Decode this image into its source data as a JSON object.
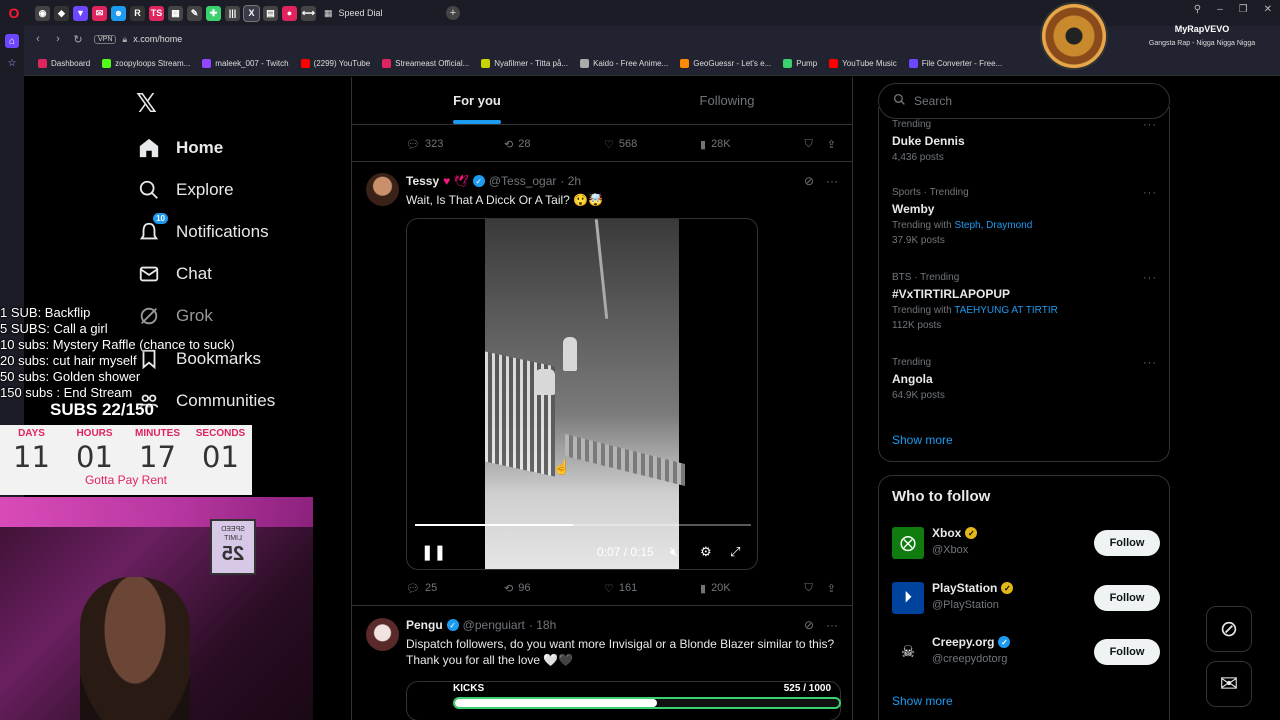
{
  "browser": {
    "speed_dial_tab": "Speed Dial",
    "url": "x.com/home",
    "vpn": "VPN",
    "bookmarks": [
      {
        "label": "Dashboard",
        "color": "#e0245e"
      },
      {
        "label": "zoopyloops Stream...",
        "color": "#53fc18"
      },
      {
        "label": "maleek_007 - Twitch",
        "color": "#9146ff"
      },
      {
        "label": "(2299) YouTube",
        "color": "#ff0000"
      },
      {
        "label": "Streameast Official...",
        "color": "#e0245e"
      },
      {
        "label": "Nyafilmer - Titta på...",
        "color": "#c8d400"
      },
      {
        "label": "Kaido - Free Anime...",
        "color": "#aaaaaa"
      },
      {
        "label": "GeoGuessr - Let's e...",
        "color": "#ff8a00"
      },
      {
        "label": "Pump",
        "color": "#3bd16f"
      },
      {
        "label": "YouTube Music",
        "color": "#ff0000"
      },
      {
        "label": "File Converter - Free...",
        "color": "#6c47ff"
      }
    ]
  },
  "music": {
    "title": "MyRapVEVO",
    "subtitle": "Gangsta Rap - Nigga Nigga Nigga"
  },
  "nav": {
    "home": "Home",
    "explore": "Explore",
    "notifications": "Notifications",
    "notif_badge": "10",
    "chat": "Chat",
    "grok": "Grok",
    "bookmarks": "Bookmarks",
    "communities": "Communities"
  },
  "feed": {
    "tabs": [
      "For you",
      "Following"
    ],
    "prev_stats": {
      "replies": "323",
      "reposts": "28",
      "likes": "568",
      "views": "28K"
    },
    "tweet1": {
      "name": "Tessy",
      "emoji": "♥ 🕊",
      "handle": "@Tess_ogar",
      "time": "· 2h",
      "text": "Wait, Is That A Dicck Or A Tail? 😲🤯",
      "video_time": "0:07 / 0:15",
      "video_progress": 0.47,
      "stats": {
        "replies": "25",
        "reposts": "96",
        "likes": "161",
        "views": "20K"
      }
    },
    "tweet2": {
      "name": "Pengu",
      "handle": "@penguiart",
      "time": "· 18h",
      "text": "Dispatch followers, do you want more Invisigal or a Blonde Blazer similar to this? Thank you for all the love 🤍🖤"
    }
  },
  "sidebar": {
    "search_placeholder": "Search",
    "trends": [
      {
        "meta": "Trending",
        "name": "Duke Dennis",
        "with": "",
        "with_names": "",
        "count": "4,436 posts"
      },
      {
        "meta": "Sports · Trending",
        "name": "Wemby",
        "with": "Trending with",
        "with_names": "Steph, Draymond",
        "count": "37.9K posts"
      },
      {
        "meta": "BTS · Trending",
        "name": "#VxTIRTIRLAPOPUP",
        "with": "Trending with",
        "with_names": "TAEHYUNG AT TIRTIR",
        "count": "112K posts"
      },
      {
        "meta": "Trending",
        "name": "Angola",
        "with": "",
        "with_names": "",
        "count": "64.9K posts"
      }
    ],
    "show_more": "Show more",
    "who_to_follow": "Who to follow",
    "follow_label": "Follow",
    "accounts": [
      {
        "name": "Xbox",
        "handle": "@Xbox",
        "color": "#107c10"
      },
      {
        "name": "PlayStation",
        "handle": "@PlayStation",
        "color": "#00439c"
      },
      {
        "name": "Creepy.org",
        "handle": "@creepydotorg",
        "color": "#000000"
      }
    ]
  },
  "overlay": {
    "goals": [
      "1 SUB: Backflip",
      "5 SUBS: Call a girl",
      "10 subs: Mystery Raffle (chance to suck)",
      "20 subs: cut hair myself",
      "50 subs: Golden shower",
      "150 subs : End Stream"
    ],
    "subs": "SUBS 22/150",
    "countdown": [
      {
        "label": "DAYS",
        "value": "11"
      },
      {
        "label": "HOURS",
        "value": "01"
      },
      {
        "label": "MINUTES",
        "value": "17"
      },
      {
        "label": "SECONDS",
        "value": "01"
      }
    ],
    "rent": "Gotta Pay Rent",
    "sign_top": "SPEED LIMIT",
    "sign_value": "25",
    "kicks_label": "KICKS",
    "kicks_count": "525  / 1000",
    "kicks_progress": 0.525
  }
}
